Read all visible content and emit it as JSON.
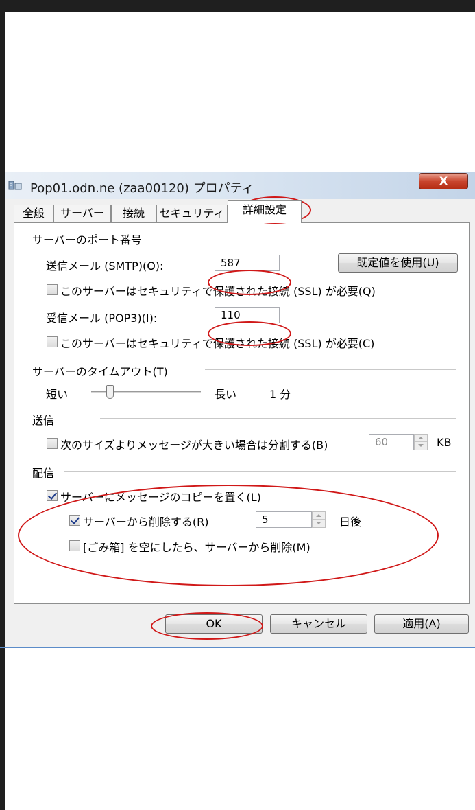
{
  "window": {
    "title": "Pop01.odn.ne (zaa00120) プロパティ",
    "close_glyph": "X"
  },
  "tabs": [
    {
      "label": "全般"
    },
    {
      "label": "サーバー"
    },
    {
      "label": "接続"
    },
    {
      "label": "セキュリティ"
    },
    {
      "label": "詳細設定"
    }
  ],
  "ports": {
    "group_label": "サーバーのポート番号",
    "smtp_label": "送信メール (SMTP)(O):",
    "smtp_value": "587",
    "default_button": "既定値を使用(U)",
    "smtp_ssl_label": "このサーバーはセキュリティで保護された接続 (SSL) が必要(Q)",
    "smtp_ssl_checked": false,
    "pop3_label": "受信メール (POP3)(I):",
    "pop3_value": "110",
    "pop3_ssl_label": "このサーバーはセキュリティで保護された接続 (SSL) が必要(C)",
    "pop3_ssl_checked": false
  },
  "timeout": {
    "group_label": "サーバーのタイムアウト(T)",
    "short_label": "短い",
    "long_label": "長い",
    "value_text": "1 分",
    "slider_level": 0.15
  },
  "send": {
    "group_label": "送信",
    "split_label": "次のサイズよりメッセージが大きい場合は分割する(B)",
    "split_checked": false,
    "size_value": "60",
    "size_unit": "KB"
  },
  "delivery": {
    "group_label": "配信",
    "leave_copy_label": "サーバーにメッセージのコピーを置く(L)",
    "leave_copy_checked": true,
    "remove_after_label": "サーバーから削除する(R)",
    "remove_after_checked": true,
    "days_value": "5",
    "days_unit": "日後",
    "remove_on_empty_label": "[ごみ箱] を空にしたら、サーバーから削除(M)",
    "remove_on_empty_checked": false
  },
  "buttons": {
    "ok": "OK",
    "cancel": "キャンセル",
    "apply": "適用(A)"
  },
  "colors": {
    "highlight_ring": "#d01818"
  }
}
